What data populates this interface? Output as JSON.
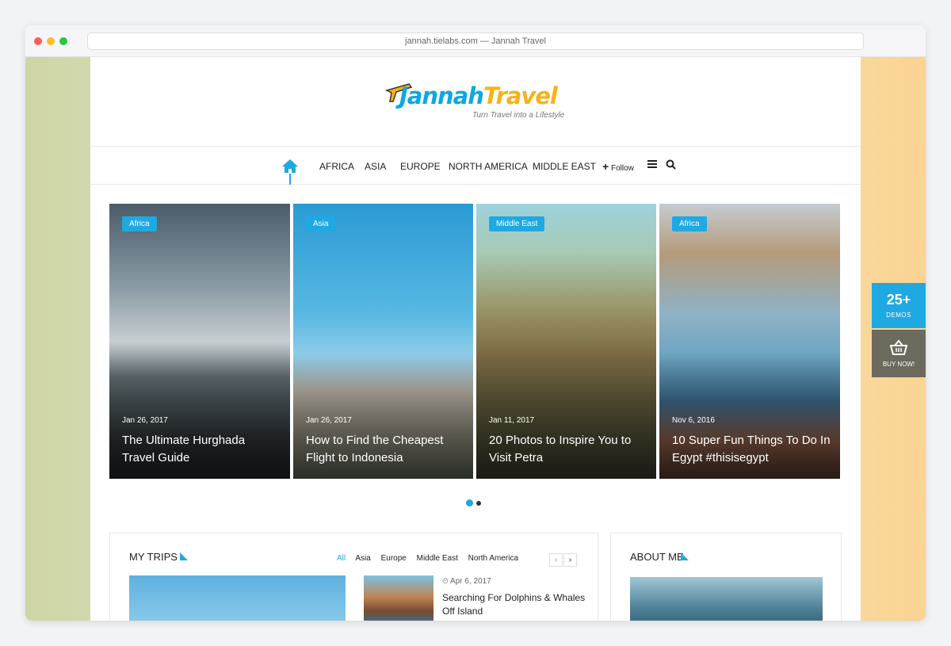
{
  "browser": {
    "url_title": "jannah.tielabs.com — Jannah Travel"
  },
  "logo": {
    "name_part1": "Jannah",
    "name_part2": "Travel",
    "tagline": "Turn Travel into a Lifestyle"
  },
  "nav": {
    "home_icon": "home-icon",
    "items": [
      "AFRICA",
      "ASIA",
      "EUROPE",
      "NORTH AMERICA",
      "MIDDLE EAST"
    ],
    "follow_label": "Follow",
    "menu_icon": "hamburger-icon",
    "search_icon": "search-icon"
  },
  "slider": {
    "slides": [
      {
        "category": "Africa",
        "date": "Jan 26, 2017",
        "title": "The Ultimate Hurghada Travel Guide"
      },
      {
        "category": "Asia",
        "date": "Jan 26, 2017",
        "title": "How to Find the Cheapest Flight to Indonesia"
      },
      {
        "category": "Middle East",
        "date": "Jan 11, 2017",
        "title": "20 Photos to Inspire You to Visit Petra"
      },
      {
        "category": "Africa",
        "date": "Nov 6, 2016",
        "title": "10 Super Fun Things To Do In Egypt #thisisegypt"
      }
    ],
    "active_page": 1,
    "page_count": 2
  },
  "trips": {
    "title": "MY TRIPS",
    "filters": [
      "All",
      "Asia",
      "Europe",
      "Middle East",
      "North America"
    ],
    "active_filter": "All",
    "post": {
      "date": "Apr 6, 2017",
      "title": "Searching For Dolphins & Whales Off Island"
    }
  },
  "about": {
    "title": "ABOUT ME"
  },
  "side_widgets": {
    "demos_count": "25+",
    "demos_label": "DEMOS",
    "buy_label": "BUY NOW!"
  },
  "colors": {
    "accent": "#1fa9e3",
    "logo_yellow": "#f7b21a",
    "buy_bg": "#6b6a5d"
  }
}
